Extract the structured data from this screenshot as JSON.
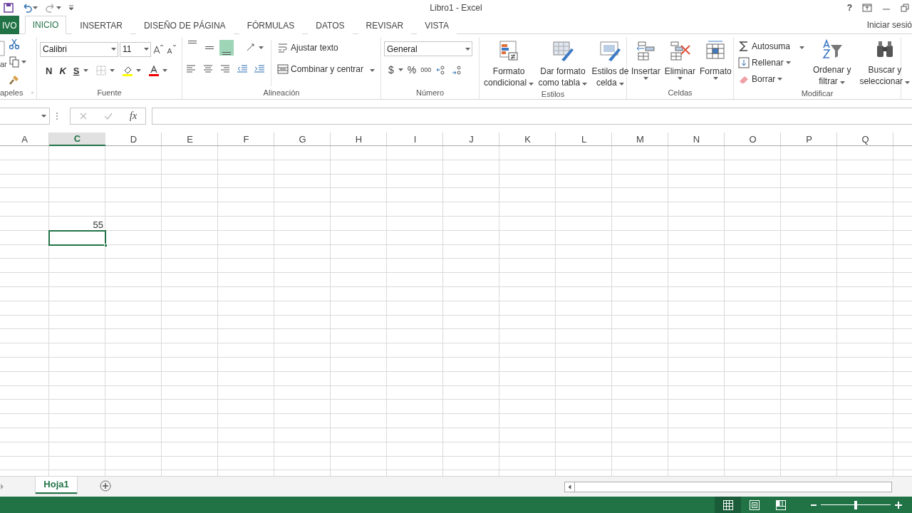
{
  "title_bar": {
    "title": "Libro1 - Excel",
    "help": "?"
  },
  "ribbon_tabs": [
    {
      "label": "IVO",
      "kind": "file",
      "selected": false
    },
    {
      "label": "INICIO",
      "kind": "tab",
      "selected": true
    },
    {
      "label": "INSERTAR",
      "kind": "tab",
      "selected": false
    },
    {
      "label": "DISEÑO DE PÁGINA",
      "kind": "tab",
      "selected": false
    },
    {
      "label": "FÓRMULAS",
      "kind": "tab",
      "selected": false
    },
    {
      "label": "DATOS",
      "kind": "tab",
      "selected": false
    },
    {
      "label": "REVISAR",
      "kind": "tab",
      "selected": false
    },
    {
      "label": "VISTA",
      "kind": "tab",
      "selected": false
    }
  ],
  "account": {
    "label": "Iniciar sesió"
  },
  "clipboard": {
    "label": "apeles",
    "paste_label": "ar"
  },
  "font": {
    "label": "Fuente",
    "font_name": "Calibri",
    "font_size": "11",
    "bold": "N",
    "italic": "K",
    "underline": "S"
  },
  "alignment": {
    "label": "Alineación",
    "wrap_text": "Ajustar texto",
    "merge_center": "Combinar y centrar",
    "vertical_align": [
      {
        "kind": "top",
        "selected": false
      },
      {
        "kind": "middle",
        "selected": false
      },
      {
        "kind": "bottom",
        "selected": true
      }
    ]
  },
  "number": {
    "label": "Número",
    "format": "General",
    "currency": "$",
    "percent": "%",
    "thousands": "000"
  },
  "styles": {
    "label": "Estilos",
    "buttons": [
      {
        "kind": "conditional",
        "lines": [
          "Formato",
          "condicional"
        ]
      },
      {
        "kind": "table",
        "lines": [
          "Dar formato",
          "como tabla"
        ]
      },
      {
        "kind": "cell",
        "lines": [
          "Estilos de",
          "celda"
        ]
      }
    ]
  },
  "cells_group": {
    "label": "Celdas",
    "buttons": [
      {
        "kind": "insert",
        "label": "Insertar"
      },
      {
        "kind": "delete",
        "label": "Eliminar"
      },
      {
        "kind": "format",
        "label": "Formato"
      }
    ]
  },
  "editing": {
    "label": "Modificar",
    "autosum": "Autosuma",
    "fill": "Rellenar",
    "clear": "Borrar",
    "sort": [
      "Ordenar y",
      "filtrar"
    ],
    "find": [
      "Buscar y",
      "seleccionar"
    ]
  },
  "formula_bar": {
    "fx": "fx"
  },
  "sheet": {
    "columns": [
      {
        "label": "A",
        "selected": false
      },
      {
        "label": "C",
        "selected": true,
        "value": "55"
      },
      {
        "label": "D",
        "selected": false
      },
      {
        "label": "E",
        "selected": false
      },
      {
        "label": "F",
        "selected": false
      },
      {
        "label": "G",
        "selected": false
      },
      {
        "label": "H",
        "selected": false
      },
      {
        "label": "I",
        "selected": false
      },
      {
        "label": "J",
        "selected": false
      },
      {
        "label": "K",
        "selected": false
      },
      {
        "label": "L",
        "selected": false
      },
      {
        "label": "M",
        "selected": false
      },
      {
        "label": "N",
        "selected": false
      },
      {
        "label": "O",
        "selected": false
      },
      {
        "label": "P",
        "selected": false
      },
      {
        "label": "Q",
        "selected": false
      }
    ]
  },
  "sheet_tabs": [
    {
      "label": "Hoja1",
      "selected": true
    }
  ],
  "status_bar": {
    "views": [
      {
        "kind": "normal",
        "selected": true
      },
      {
        "kind": "page_layout",
        "selected": false
      },
      {
        "kind": "page_break",
        "selected": false
      }
    ],
    "zoom": {
      "level": 0.5
    }
  }
}
